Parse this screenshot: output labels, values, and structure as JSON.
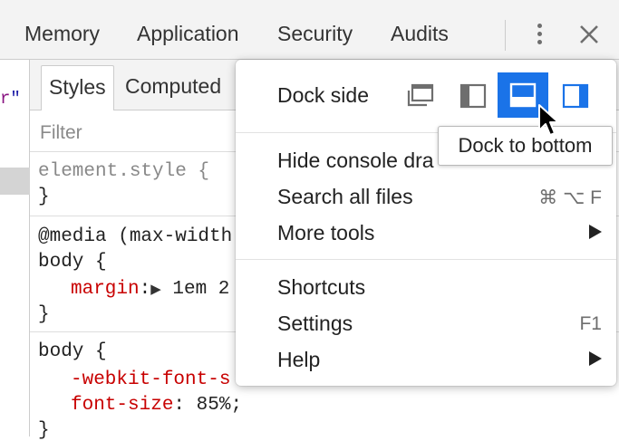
{
  "toolbar": {
    "tabs": [
      "Memory",
      "Application",
      "Security",
      "Audits"
    ],
    "more_icon": "kebab-vertical-icon",
    "close_icon": "close-icon"
  },
  "elements_panel": {
    "fragment_r": "r",
    "fragment_quote": "\""
  },
  "styles_panel": {
    "tabs": [
      "Styles",
      "Computed"
    ],
    "filter_placeholder": "Filter",
    "element_style": {
      "selector": "element.style {",
      "close": "}"
    },
    "media_rule": {
      "query": "@media (max-width",
      "selector": "body {",
      "property": "margin",
      "colon": ":",
      "value": "1em 2",
      "close": "}"
    },
    "body_rule": {
      "selector": "body {",
      "prop1": "-webkit-font-s",
      "prop2": "font-size",
      "colon2": ": ",
      "value2": "85%;",
      "close": "}"
    }
  },
  "menu": {
    "dock_side": {
      "label": "Dock side",
      "options": [
        "undock-icon",
        "dock-left-icon",
        "dock-bottom-icon",
        "dock-right-icon"
      ],
      "selected": "dock-bottom-icon"
    },
    "items": [
      {
        "label": "Hide console drawer",
        "visible_label": "Hide console dra"
      },
      {
        "label": "Search all files",
        "shortcut": "⌘ ⌥ F"
      },
      {
        "label": "More tools",
        "submenu": true
      },
      {
        "label": "Shortcuts"
      },
      {
        "label": "Settings",
        "shortcut": "F1"
      },
      {
        "label": "Help",
        "submenu": true
      }
    ]
  },
  "tooltip": {
    "text": "Dock to bottom"
  },
  "colors": {
    "accent": "#1a73e8",
    "css_property": "#c80000",
    "toolbar_bg": "#f3f3f3"
  }
}
